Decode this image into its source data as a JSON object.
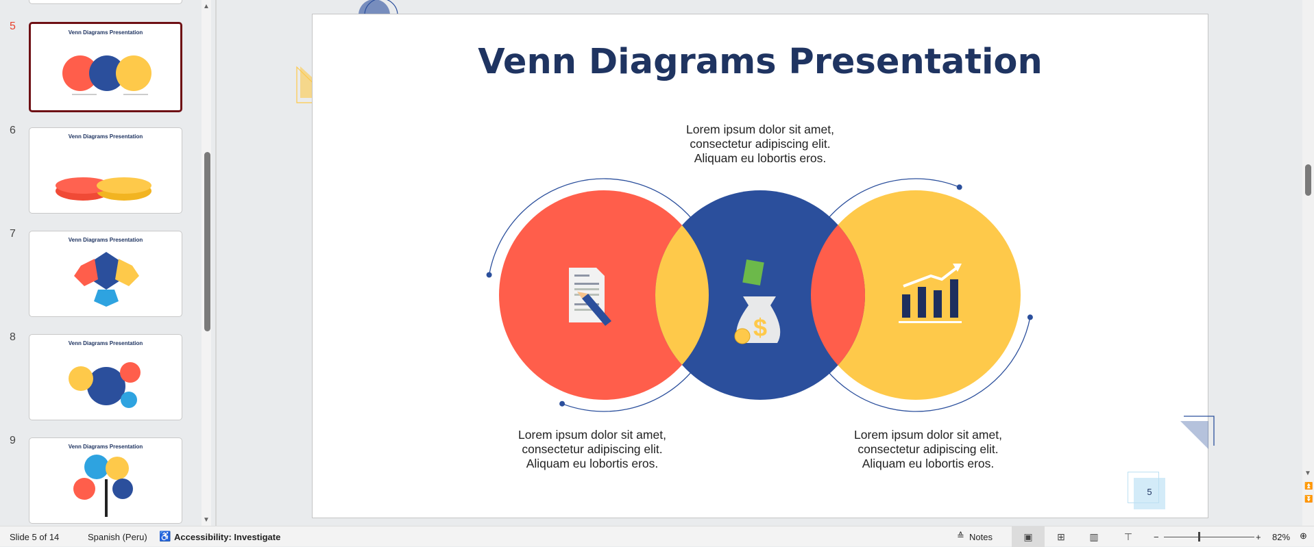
{
  "thumbnails": [
    {
      "number": "5",
      "title": "Venn Diagrams Presentation",
      "selected": true
    },
    {
      "number": "6",
      "title": "Venn Diagrams Presentation"
    },
    {
      "number": "7",
      "title": "Venn Diagrams Presentation"
    },
    {
      "number": "8",
      "title": "Venn Diagrams Presentation"
    },
    {
      "number": "9",
      "title": "Venn Diagrams Presentation"
    }
  ],
  "slide": {
    "title": "Venn Diagrams Presentation",
    "top_text": [
      "Lorem ipsum dolor sit amet,",
      "consectetur adipiscing elit.",
      "Aliquam eu lobortis eros."
    ],
    "left_text": [
      "Lorem ipsum dolor sit amet,",
      "consectetur adipiscing elit.",
      "Aliquam eu lobortis eros."
    ],
    "right_text": [
      "Lorem ipsum dolor sit amet,",
      "consectetur adipiscing elit.",
      "Aliquam eu lobortis eros."
    ],
    "page_number": "5",
    "icons": [
      "document-pencil-icon",
      "money-bag-icon",
      "bar-chart-growth-icon"
    ],
    "colors": {
      "red": "#ff5e4b",
      "blue": "#2b4f9c",
      "yellow": "#fec94a",
      "title": "#1f3461"
    }
  },
  "status": {
    "slide_info": "Slide 5 of 14",
    "language": "Spanish (Peru)",
    "accessibility": "Accessibility: Investigate",
    "notes": "Notes",
    "zoom": "82%"
  }
}
